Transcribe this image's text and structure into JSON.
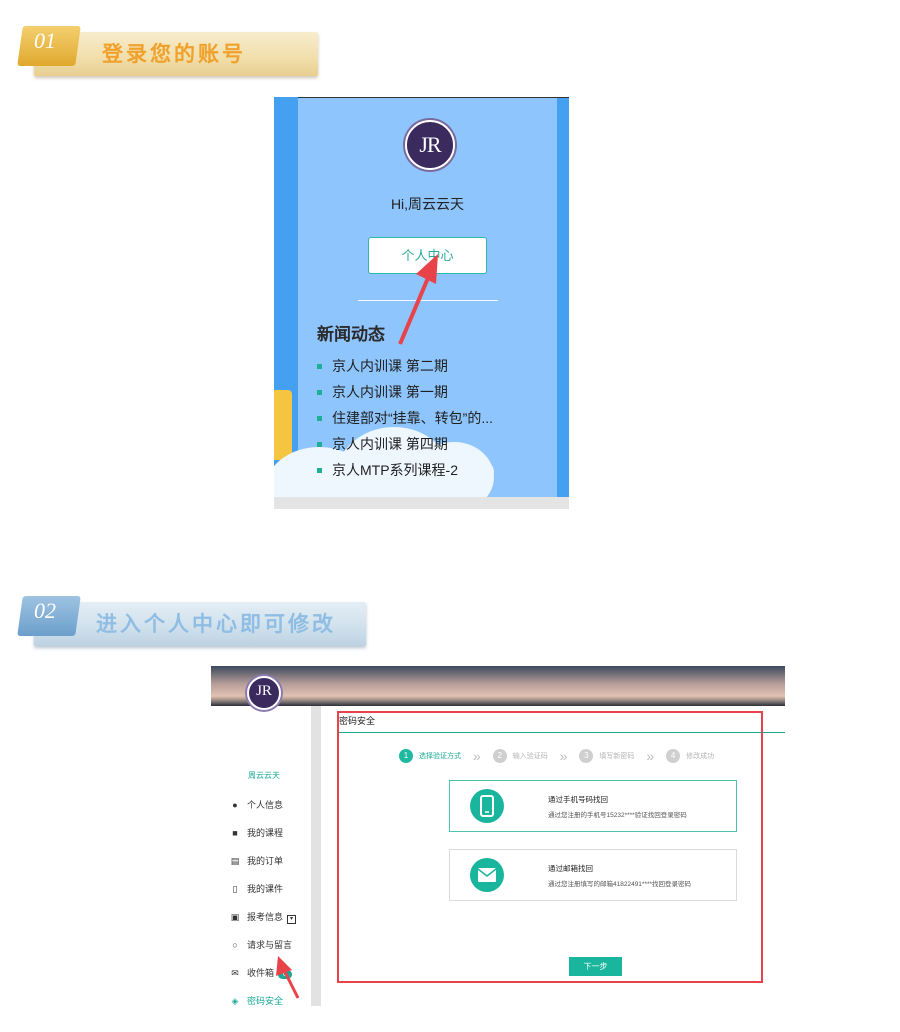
{
  "step1": {
    "number": "01",
    "title": "登录您的账号"
  },
  "screenshot1": {
    "logo_text": "JR",
    "greeting": "Hi,周云云天",
    "personal_center_button": "个人中心",
    "news_heading": "新闻动态",
    "news_items": [
      "京人内训课 第二期",
      "京人内训课 第一期",
      "住建部对“挂靠、转包”的...",
      "京人内训课 第四期",
      "京人MTP系列课程-2"
    ]
  },
  "step2": {
    "number": "02",
    "title": "进入个人中心即可修改"
  },
  "screenshot2": {
    "logo_text": "JR",
    "username": "周云云天",
    "menu": [
      {
        "label": "个人信息",
        "icon": "user-icon"
      },
      {
        "label": "我的课程",
        "icon": "book-icon"
      },
      {
        "label": "我的订单",
        "icon": "order-icon"
      },
      {
        "label": "我的课件",
        "icon": "folder-icon"
      },
      {
        "label": "报考信息",
        "icon": "card-icon"
      },
      {
        "label": "请求与留言",
        "icon": "chat-icon"
      },
      {
        "label": "收件箱",
        "icon": "mail-icon",
        "badge": "0"
      },
      {
        "label": "密码安全",
        "icon": "shield-icon",
        "active": true
      }
    ],
    "panel_title": "密码安全",
    "steps": [
      {
        "n": "1",
        "label": "选择验证方式",
        "active": true
      },
      {
        "n": "2",
        "label": "输入验证码"
      },
      {
        "n": "3",
        "label": "填写新密码"
      },
      {
        "n": "4",
        "label": "修改成功"
      }
    ],
    "options": [
      {
        "title": "通过手机号码找回",
        "desc": "通过您注册的手机号15232****验证找回登录密码",
        "icon": "phone-icon",
        "selected": true
      },
      {
        "title": "通过邮箱找回",
        "desc": "通过您注册填写的邮箱41822491****找回登录密码",
        "icon": "envelope-icon"
      }
    ],
    "next_button": "下一步"
  },
  "colors": {
    "accent": "#1ab59d",
    "annotation_red": "#e8424a",
    "banner1_text": "#f0a12c",
    "banner2_text": "#8fbde3"
  }
}
